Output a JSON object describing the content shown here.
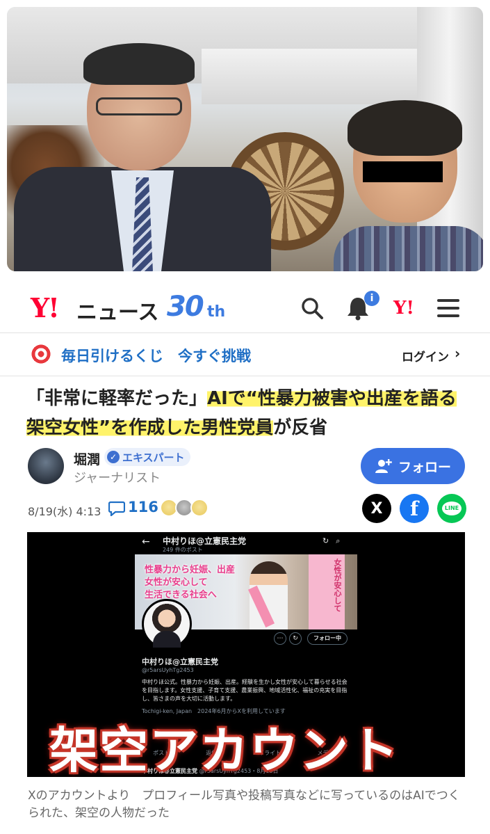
{
  "header": {
    "logo_y": "Y!",
    "logo_news": "ニュース",
    "logo_30": "30",
    "logo_th": "th",
    "bell_badge": "i",
    "yahoo_icon": "Y!"
  },
  "promo": {
    "text": "毎日引けるくじ　今すぐ挑戦",
    "login": "ログイン",
    "login_chevron": "›"
  },
  "article": {
    "title_part1": "「非常に軽率だった」",
    "title_highlight": "AIで“性暴力被害や出産を語る架空女性”を作成した男性党員",
    "title_part2": "が反省"
  },
  "author": {
    "name": "堀潤",
    "badge": "エキスパート",
    "role": "ジャーナリスト",
    "follow_label": "フォロー"
  },
  "meta": {
    "date": "8/19(水) 4:13",
    "comment_count": "116"
  },
  "share": {
    "x_label": "X",
    "fb_label": "f",
    "line_label": "LINE"
  },
  "embed": {
    "x_back": "←",
    "x_name": "中村りほ@立憲民主党",
    "x_posts": "249 件のポスト",
    "banner_text": [
      "性暴力から妊娠、出産",
      "女性が安心して",
      "生活できる社会へ"
    ],
    "banner_flag": "女性が安心して",
    "following": "フォロー中",
    "profile_name": "中村りほ@立憲民主党",
    "handle": "@r5arsUyhTg2453",
    "bio": "中村りほ公式。性暴力から妊娠、出産。経験を生かし女性が安心して暮らせる社会を目指します。女性支援、子育て支援、農業振興、地域活性化、福祉の充実を目指し、皆さまの声を大切に活動します。",
    "location": "Tochigi-ken, Japan　2024年6月からXを利用しています",
    "tabs": [
      "ポスト",
      "返信",
      "ハイライト",
      "メディア"
    ],
    "post_name": "中村りほ@立憲民主党",
    "post_meta": "@r5arsUyhTg2453・8月15日",
    "overlay": "架空アカウント"
  },
  "caption": "Xのアカウントより　プロフィール写真や投稿写真などに写っているのはAIでつくられた、架空の人物だった"
}
